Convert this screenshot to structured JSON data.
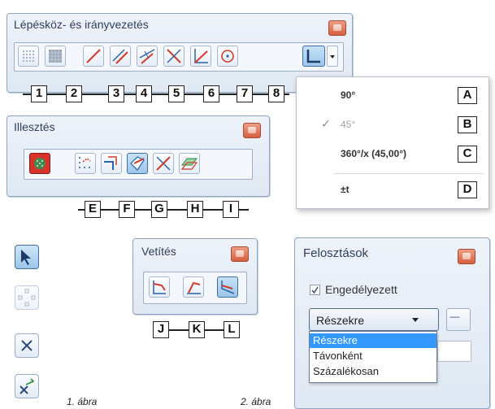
{
  "panel_lepeskoz": {
    "title": "Lépésköz- és irányvezetés",
    "labels": [
      "1",
      "2",
      "3",
      "4",
      "5",
      "6",
      "7",
      "8"
    ],
    "icons": [
      "grid-dots-icon",
      "grid-fill-icon",
      "line-icon",
      "parallel-line-icon",
      "offset-line-icon",
      "intersection-icon",
      "angle-icon",
      "circle-point-icon",
      "angle-lock-icon"
    ]
  },
  "angle_menu": {
    "items": [
      {
        "text": "90°",
        "label": "A",
        "checked": false,
        "disabled": false
      },
      {
        "text": "45°",
        "label": "B",
        "checked": true,
        "disabled": true
      },
      {
        "text": "360°/x (45,00°)",
        "label": "C",
        "checked": false,
        "disabled": false
      },
      {
        "text": "±t",
        "label": "D",
        "checked": false,
        "disabled": false
      }
    ],
    "check_glyph": "✓"
  },
  "panel_illesztes": {
    "title": "Illesztés",
    "labels": [
      "E",
      "F",
      "G",
      "H",
      "I"
    ],
    "icons": [
      "snap-toggle-icon",
      "snap-grid-icon",
      "snap-corner-icon",
      "snap-edge-icon",
      "snap-intersect-icon",
      "snap-plane-icon"
    ]
  },
  "side_tools": {
    "icons": [
      "select-arrow-icon",
      "move-nodes-icon",
      "delete-x-icon",
      "undo-x-icon"
    ]
  },
  "panel_vetites": {
    "title": "Vetítés",
    "labels": [
      "J",
      "K",
      "L"
    ],
    "icons": [
      "projection-corner-icon",
      "projection-angle-icon",
      "projection-perpendicular-icon"
    ]
  },
  "panel_felosztasok": {
    "title": "Felosztások",
    "enabled_label": "Engedélyezett",
    "enabled_checked": true,
    "select_value": "Részekre",
    "more_button_glyph": "-----",
    "options": [
      "Részekre",
      "Távonként",
      "Százalékosan"
    ],
    "selected_option": "Részekre"
  },
  "captions": {
    "fig1": "1. ábra",
    "fig2": "2. ábra"
  },
  "colors": {
    "accent_red": "#d6603f",
    "selection_blue": "#3399ff",
    "icon_blue": "#2a63a8",
    "icon_red": "#d23b2a"
  }
}
